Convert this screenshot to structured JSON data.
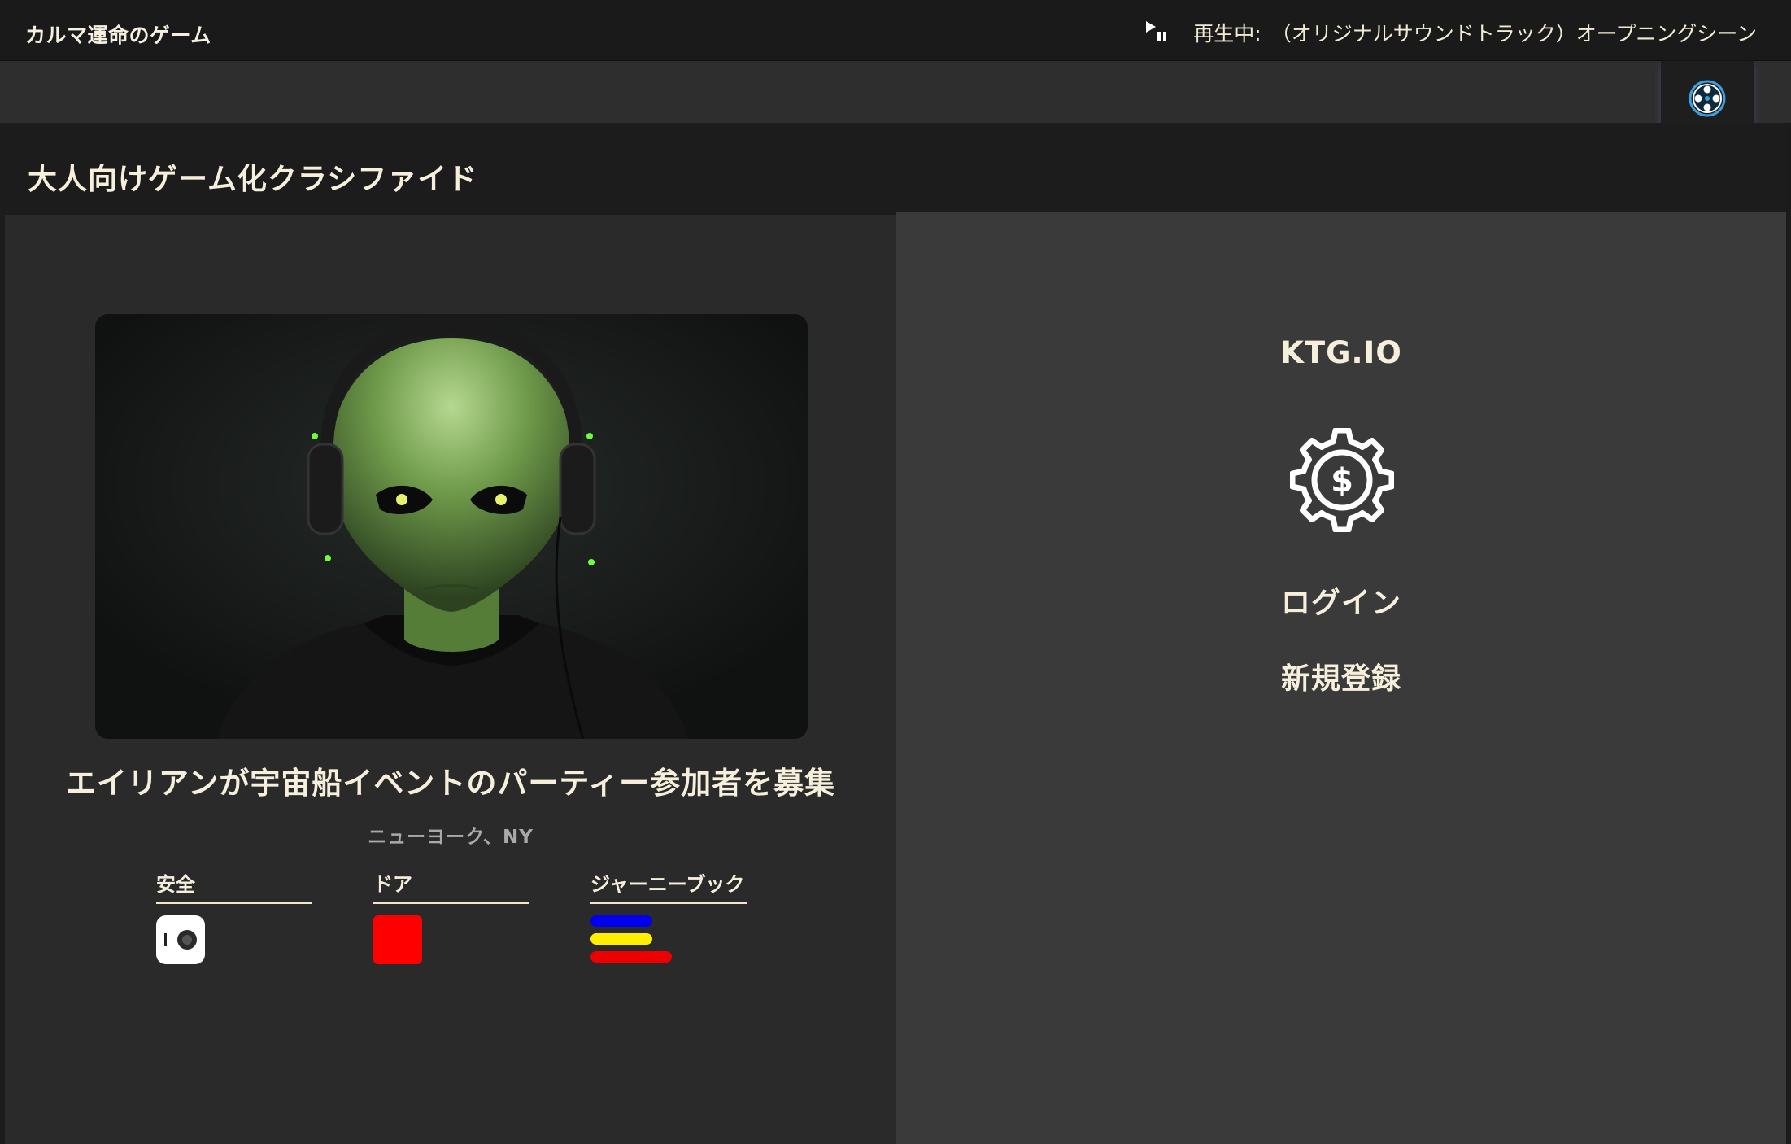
{
  "app": {
    "title": "カルマ運命のゲーム"
  },
  "now_playing": {
    "label": "再生中:",
    "track": "（オリジナルサウンドトラック）オープニングシーン",
    "icon": "play-pause-icon"
  },
  "settings": {
    "icon": "film-reel-icon",
    "accent": "#3aa0e0"
  },
  "section": {
    "title": "大人向けゲーム化クラシファイド"
  },
  "listing": {
    "image_alt": "alien-with-headphones",
    "title": "エイリアンが宇宙船イベントのパーティー参加者を募集",
    "location": "ニューヨーク、NY",
    "features": [
      {
        "label": "安全",
        "icon": "toggle-switch-icon"
      },
      {
        "label": "ドア",
        "icon": "red-square-icon",
        "color": "#ff0000"
      },
      {
        "label": "ジャーニーブック",
        "icon": "striped-book-icon",
        "colors": [
          "#0000ee",
          "#ffee00",
          "#ee0000"
        ]
      }
    ]
  },
  "sidebar": {
    "brand": "KTG.IO",
    "icon": "gear-dollar-icon",
    "login_label": "ログイン",
    "register_label": "新規登録"
  }
}
